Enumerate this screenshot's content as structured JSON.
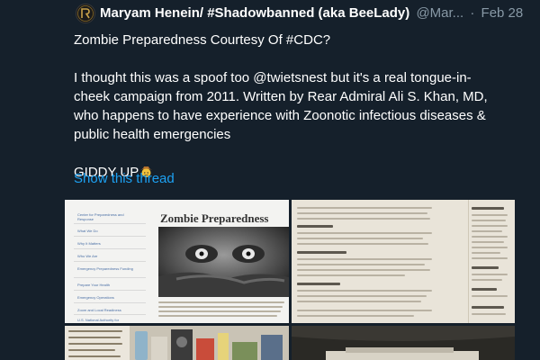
{
  "tweet": {
    "author_name": "Maryam Henein/ #Shadowbanned (aka BeeLady)",
    "handle": "@Mar...",
    "separator": "·",
    "date": "Feb 28",
    "line1": "Zombie Preparedness Courtesy Of #CDC?",
    "line2": "I thought this was a spoof too @twietsnest  but it's a real tongue-in-cheek campaign from 2011. Written by Rear Admiral Ali S. Khan, MD, who happens to have experience with Zoonotic infectious diseases & public health emergencies",
    "line3": "GIDDY UP",
    "emoji": "cowboy-face-emoji",
    "show_thread": "Show this thread"
  },
  "media": {
    "image1": {
      "title": "Zombie Preparedness",
      "sidebar": [
        "Center for Preparedness and Response",
        "What We Do",
        "Why It Matters",
        "Who We Are",
        "Emergency Preparedness Funding",
        "Prepare Your Health",
        "Emergency Operations",
        "Zoom and Local Readiness",
        "U.S. National Authority for"
      ]
    },
    "image2": {
      "headings": [
        "Learn More",
        "Contact"
      ]
    }
  },
  "colors": {
    "background": "#15202b",
    "text": "#ffffff",
    "muted": "#8899a6",
    "link": "#1da1f2"
  }
}
